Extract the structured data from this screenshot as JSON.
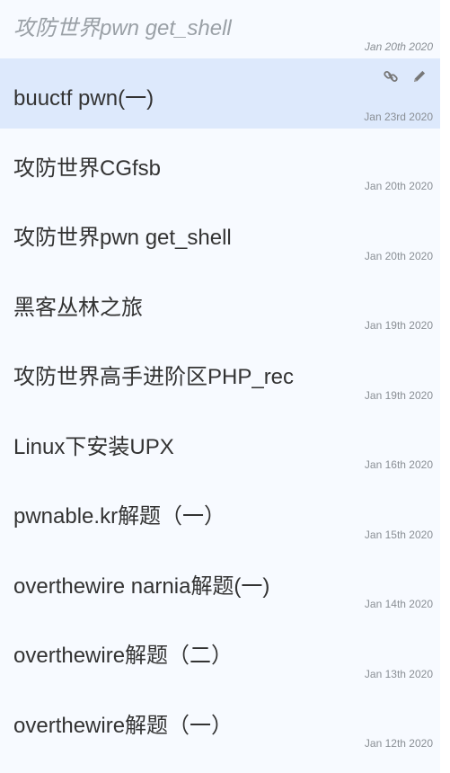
{
  "notes": [
    {
      "title": "攻防世界pwn get_shell",
      "date": "Jan 20th 2020",
      "state": "editing"
    },
    {
      "title": "buuctf pwn(一)",
      "date": "Jan 23rd 2020",
      "state": "active"
    },
    {
      "title": "攻防世界CGfsb",
      "date": "Jan 20th 2020"
    },
    {
      "title": "攻防世界pwn get_shell",
      "date": "Jan 20th 2020"
    },
    {
      "title": "黑客丛林之旅",
      "date": "Jan 19th 2020"
    },
    {
      "title": "攻防世界高手进阶区PHP_rec",
      "date": "Jan 19th 2020"
    },
    {
      "title": "Linux下安装UPX",
      "date": "Jan 16th 2020"
    },
    {
      "title": "pwnable.kr解题（一）",
      "date": "Jan 15th 2020"
    },
    {
      "title": "overthewire narnia解题(一)",
      "date": "Jan 14th 2020"
    },
    {
      "title": "overthewire解题（二）",
      "date": "Jan 13th 2020"
    },
    {
      "title": "overthewire解题（一）",
      "date": "Jan 12th 2020"
    }
  ],
  "icons": {
    "link": "link-icon",
    "edit": "pencil-icon"
  },
  "colors": {
    "active_background": "#dde9fc",
    "list_background": "#f7faff",
    "title_text": "#333333",
    "date_text": "#8a8f95",
    "icon": "#777777"
  }
}
